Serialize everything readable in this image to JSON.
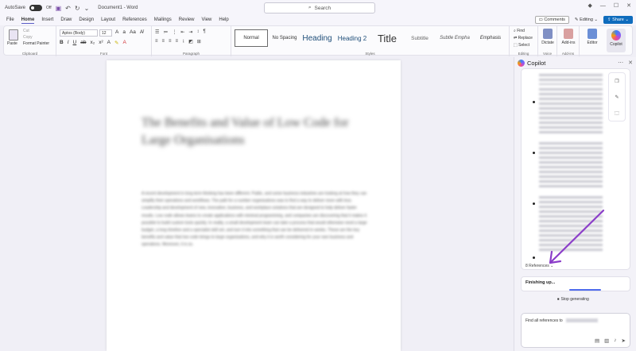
{
  "titlebar": {
    "autosave_label": "AutoSave",
    "toggle_state": "Off",
    "doc_title": "Document1 - Word",
    "search_placeholder": "Search",
    "icons": [
      "save-icon",
      "undo-icon",
      "redo-icon",
      "customize-icon",
      "diamond-icon",
      "minimize-icon",
      "maximize-icon",
      "close-icon"
    ]
  },
  "menu": {
    "tabs": [
      "File",
      "Home",
      "Insert",
      "Draw",
      "Design",
      "Layout",
      "References",
      "Mailings",
      "Review",
      "View",
      "Help"
    ],
    "active_tab": "Home",
    "comments": "Comments",
    "editing": "Editing",
    "share": "Share"
  },
  "ribbon": {
    "clipboard": {
      "paste": "Paste",
      "cut": "Cut",
      "copy": "Copy",
      "format_painter": "Format Painter",
      "label": "Clipboard"
    },
    "font": {
      "font_name": "Aptos (Body)",
      "font_size": "12",
      "label": "Font"
    },
    "paragraph": {
      "label": "Paragraph"
    },
    "styles": {
      "items": [
        "Normal",
        "No Spacing",
        "Heading",
        "Heading 2",
        "Title",
        "Subtitle",
        "Subtle Empha",
        "Emphasis"
      ],
      "label": "Styles"
    },
    "editing": {
      "find": "Find",
      "replace": "Replace",
      "select": "Select",
      "label": "Editing"
    },
    "voice": {
      "dictate": "Dictate",
      "label": "Voice"
    },
    "addins": {
      "addins": "Add-ins",
      "label": "Add-ins"
    },
    "editor": "Editor",
    "copilot": "Copilot"
  },
  "document": {
    "heading": "The Benefits and Value of Low Code for Large Organisations",
    "body": "A recent development in long term thinking has been different. Public, and some business industries are looking at how they can simplify their operations and workflows. The path for a number organisations was to find a way to deliver more with less. Leadership and development of new, innovative, business, and workplace solutions that are designed to help deliver faster results. Low code allows teams to create applications with minimal programming, and companies are discovering that it makes it possible to build custom tools quickly. In reality, a small development team can take a process that would otherwise need a large budget, a long timeline and a specialist skill set, and turn it into something that can be delivered in weeks. These are the key benefits and value that low code brings to large organisations, and why it is worth considering for your own business and operations. Moreover, it is so."
  },
  "copilot": {
    "title": "Copilot",
    "references": "8 References",
    "status": "Finishing up...",
    "stop": "Stop generating",
    "input_text": "Find all references to",
    "accent_color": "#8b3dc9"
  }
}
